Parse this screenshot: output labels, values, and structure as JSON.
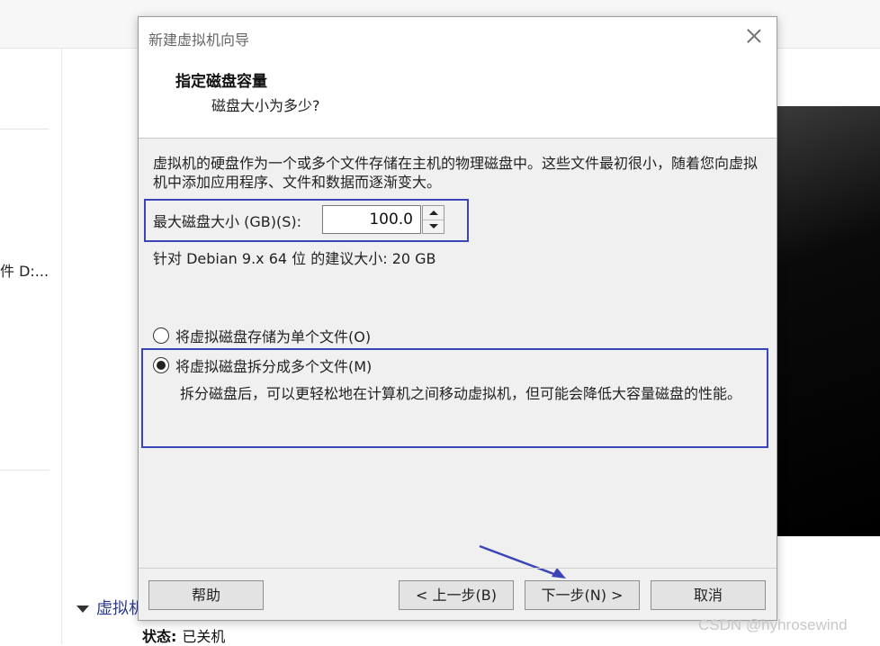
{
  "background": {
    "path_fragment": "件 D:...",
    "section_label": "虚拟机",
    "status_label": "状态:",
    "status_value": "已关机"
  },
  "dialog": {
    "title": "新建虚拟机向导",
    "header_title": "指定磁盘容量",
    "header_subtitle": "磁盘大小为多少?",
    "description": "虚拟机的硬盘作为一个或多个文件存储在主机的物理磁盘中。这些文件最初很小，随着您向虚拟机中添加应用程序、文件和数据而逐渐变大。",
    "max_size_label": "最大磁盘大小 (GB)(S):",
    "max_size_value": "100.0",
    "recommended": "针对 Debian 9.x 64 位 的建议大小: 20 GB",
    "options": [
      {
        "label": "将虚拟磁盘存储为单个文件(O)",
        "selected": false
      },
      {
        "label": "将虚拟磁盘拆分成多个文件(M)",
        "selected": true
      }
    ],
    "split_description": "拆分磁盘后，可以更轻松地在计算机之间移动虚拟机，但可能会降低大容量磁盘的性能。",
    "buttons": {
      "help": "帮助",
      "back": "< 上一步(B)",
      "next": "下一步(N) >",
      "cancel": "取消"
    }
  },
  "watermark": "CSDN @hyhrosewind",
  "colors": {
    "highlight_frame": "#3b45b8",
    "annotation_arrow": "#3b45b8"
  }
}
